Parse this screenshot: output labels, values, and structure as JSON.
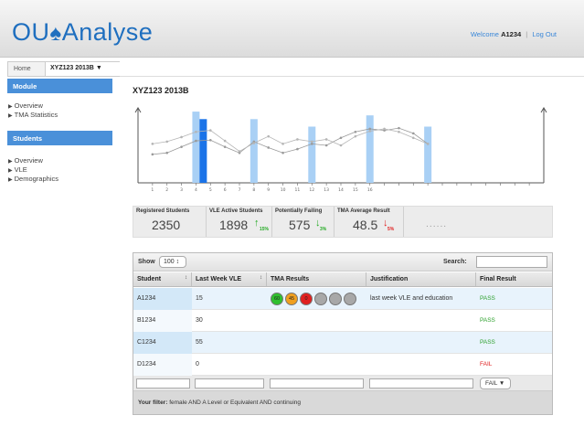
{
  "app": {
    "logo_left": "OU",
    "logo_right": "Analyse",
    "welcome_text": "Welcome",
    "user": "A1234",
    "logout": "Log Out"
  },
  "breadcrumb": {
    "home": "Home",
    "course": "XYZ123 2013B",
    "caret": "▼"
  },
  "sidebar": {
    "module_head": "Module",
    "module_items": [
      "Overview",
      "TMA Statistics"
    ],
    "students_head": "Students",
    "students_items": [
      "Overview",
      "VLE",
      "Demographics"
    ]
  },
  "page": {
    "title": "XYZ123  2013B"
  },
  "chart_data": {
    "type": "line",
    "x": [
      1,
      2,
      3,
      4,
      5,
      6,
      7,
      8,
      9,
      10,
      11,
      12,
      13,
      14,
      15,
      16
    ],
    "x_tick_labels": [
      "1",
      "2",
      "3",
      "4",
      "5",
      "6",
      "7",
      "8",
      "9",
      "10",
      "11",
      "12",
      "13",
      "14",
      "15",
      "16"
    ],
    "series": [
      {
        "values": [
          0.38,
          0.4,
          0.48,
          0.56,
          0.57,
          0.48,
          0.4,
          0.55,
          0.47,
          0.4,
          0.45,
          0.52,
          0.5,
          0.6,
          0.68,
          0.72,
          0.7,
          0.73,
          0.66,
          0.52
        ]
      },
      {
        "values": [
          0.52,
          0.55,
          0.61,
          0.68,
          0.7,
          0.56,
          0.42,
          0.53,
          0.62,
          0.52,
          0.58,
          0.55,
          0.58,
          0.5,
          0.62,
          0.69,
          0.72,
          0.68,
          0.6,
          0.52
        ]
      }
    ],
    "bars": [
      {
        "x": 4,
        "value": 0.95,
        "highlight": false
      },
      {
        "x": 4.5,
        "value": 0.85,
        "highlight": true
      },
      {
        "x": 8,
        "value": 0.85,
        "highlight": false
      },
      {
        "x": 12,
        "value": 0.75,
        "highlight": false
      },
      {
        "x": 16,
        "value": 0.9,
        "highlight": false
      },
      {
        "x": 20,
        "value": 0.75,
        "highlight": false
      }
    ]
  },
  "stats": [
    {
      "label": "Registered Students",
      "value": "2350",
      "arrow": "",
      "pct": "",
      "color": ""
    },
    {
      "label": "VLE Active Students",
      "value": "1898",
      "arrow": "↑",
      "pct": "15%",
      "color": "#22aa22"
    },
    {
      "label": "Potentially Failing",
      "value": "575",
      "arrow": "↓",
      "pct": "3%",
      "color": "#22aa22"
    },
    {
      "label": "TMA Average Result",
      "value": "48.5",
      "arrow": "↓",
      "pct": "5%",
      "color": "#e02020"
    }
  ],
  "stats_more": "......",
  "table": {
    "show_label": "Show",
    "show_value": "100",
    "search_label": "Search:",
    "columns": [
      "Student",
      "Last Week VLE",
      "TMA Results",
      "Justification",
      "Final Result"
    ],
    "rows": [
      {
        "student": "A1234",
        "vle": "15",
        "justification": "last week VLE and education",
        "result": "PASS",
        "status": "pass"
      },
      {
        "student": "B1234",
        "vle": "30",
        "justification": "",
        "result": "PASS",
        "status": "pass"
      },
      {
        "student": "C1234",
        "vle": "55",
        "justification": "",
        "result": "PASS",
        "status": "pass"
      },
      {
        "student": "D1234",
        "vle": "0",
        "justification": "",
        "result": "FAIL",
        "status": "fail"
      }
    ],
    "tma_circles": [
      {
        "label": "60",
        "color": "#2fc02f"
      },
      {
        "label": "45",
        "color": "#f0a020"
      },
      {
        "label": "0",
        "color": "#e02020"
      },
      {
        "label": "",
        "color": "#a8a8a8"
      },
      {
        "label": "",
        "color": "#a8a8a8"
      },
      {
        "label": "",
        "color": "#a8a8a8"
      }
    ],
    "filter_select": "FAIL ▼",
    "filter_prefix": "Your filter:",
    "filter_text": " female AND A Level or Equivalent AND continuing"
  }
}
